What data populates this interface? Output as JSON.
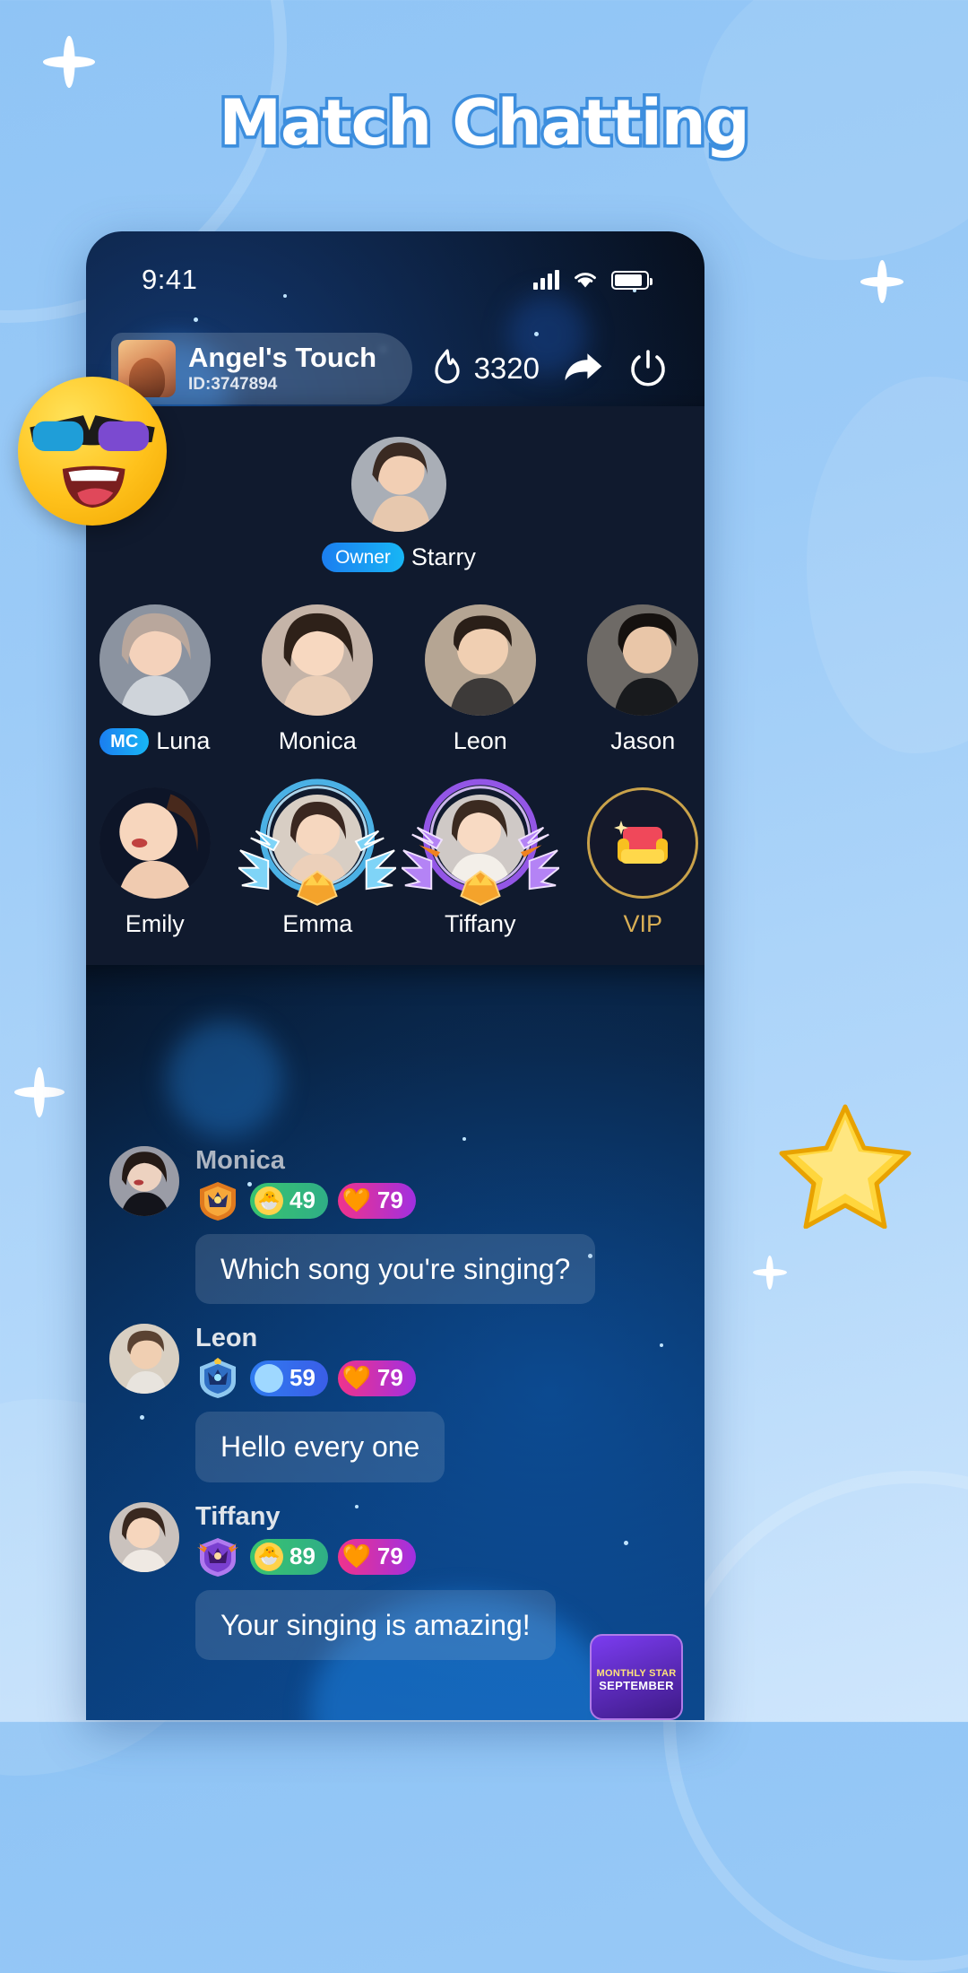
{
  "page": {
    "title": "Match Chatting",
    "accent_blue": "#3d8ede",
    "panel_bg": "#101a2e"
  },
  "status_bar": {
    "time": "9:41",
    "signal_icon": "signal-bars-icon",
    "wifi_icon": "wifi-icon",
    "battery_icon": "battery-icon"
  },
  "room_header": {
    "avatar_icon": "room-avatar",
    "name": "Angel's Touch",
    "id": "ID:3747894",
    "hot_icon": "flame-icon",
    "hot_count": "3320",
    "share_icon": "share-arrow-icon",
    "exit_icon": "power-off-icon"
  },
  "seats": {
    "owner": {
      "name": "Starry",
      "badge": "Owner",
      "avatar_icon": "avatar-starry"
    },
    "row1": [
      {
        "name": "Luna",
        "badge": "MC",
        "avatar_icon": "avatar-luna",
        "frame": "none"
      },
      {
        "name": "Monica",
        "badge": "",
        "avatar_icon": "avatar-monica",
        "frame": "none"
      },
      {
        "name": "Leon",
        "badge": "",
        "avatar_icon": "avatar-leon",
        "frame": "none"
      },
      {
        "name": "Jason",
        "badge": "",
        "avatar_icon": "avatar-jason",
        "frame": "none"
      }
    ],
    "row2": [
      {
        "name": "Emily",
        "badge": "",
        "avatar_icon": "avatar-emily",
        "frame": "none"
      },
      {
        "name": "Emma",
        "badge": "",
        "avatar_icon": "avatar-emma",
        "frame": "blue-wings"
      },
      {
        "name": "Tiffany",
        "badge": "",
        "avatar_icon": "avatar-tiffany",
        "frame": "purple-wings"
      }
    ],
    "vip": {
      "name": "VIP",
      "icon": "vip-sofa-icon",
      "border_color": "#c9a24a",
      "text_color": "#d8ae55"
    }
  },
  "chat": {
    "messages": [
      {
        "name": "Monica",
        "avatar_icon": "avatar-monica",
        "rank_icon": "gold-rank-badge-icon",
        "level": "49",
        "level_icon": "chick-level-icon",
        "level_style": "green",
        "hearts": "79",
        "heart_icon": "heart-icon",
        "text": "Which song you're singing?"
      },
      {
        "name": "Leon",
        "avatar_icon": "avatar-leon",
        "rank_icon": "blue-rank-badge-icon",
        "level": "59",
        "level_icon": "orb-level-icon",
        "level_style": "blue",
        "hearts": "79",
        "heart_icon": "heart-icon",
        "text": "Hello every one"
      },
      {
        "name": "Tiffany",
        "avatar_icon": "avatar-tiffany",
        "rank_icon": "purple-rank-badge-icon",
        "level": "89",
        "level_icon": "chick-level-icon",
        "level_style": "green",
        "hearts": "79",
        "heart_icon": "heart-icon",
        "text": "Your singing is amazing!"
      }
    ]
  },
  "stickers": {
    "emoji": "sunglasses-laughing-emoji",
    "star": "gold-star-icon",
    "gift_card_line1": "MONTHLY STAR",
    "gift_card_line2": "SEPTEMBER"
  }
}
